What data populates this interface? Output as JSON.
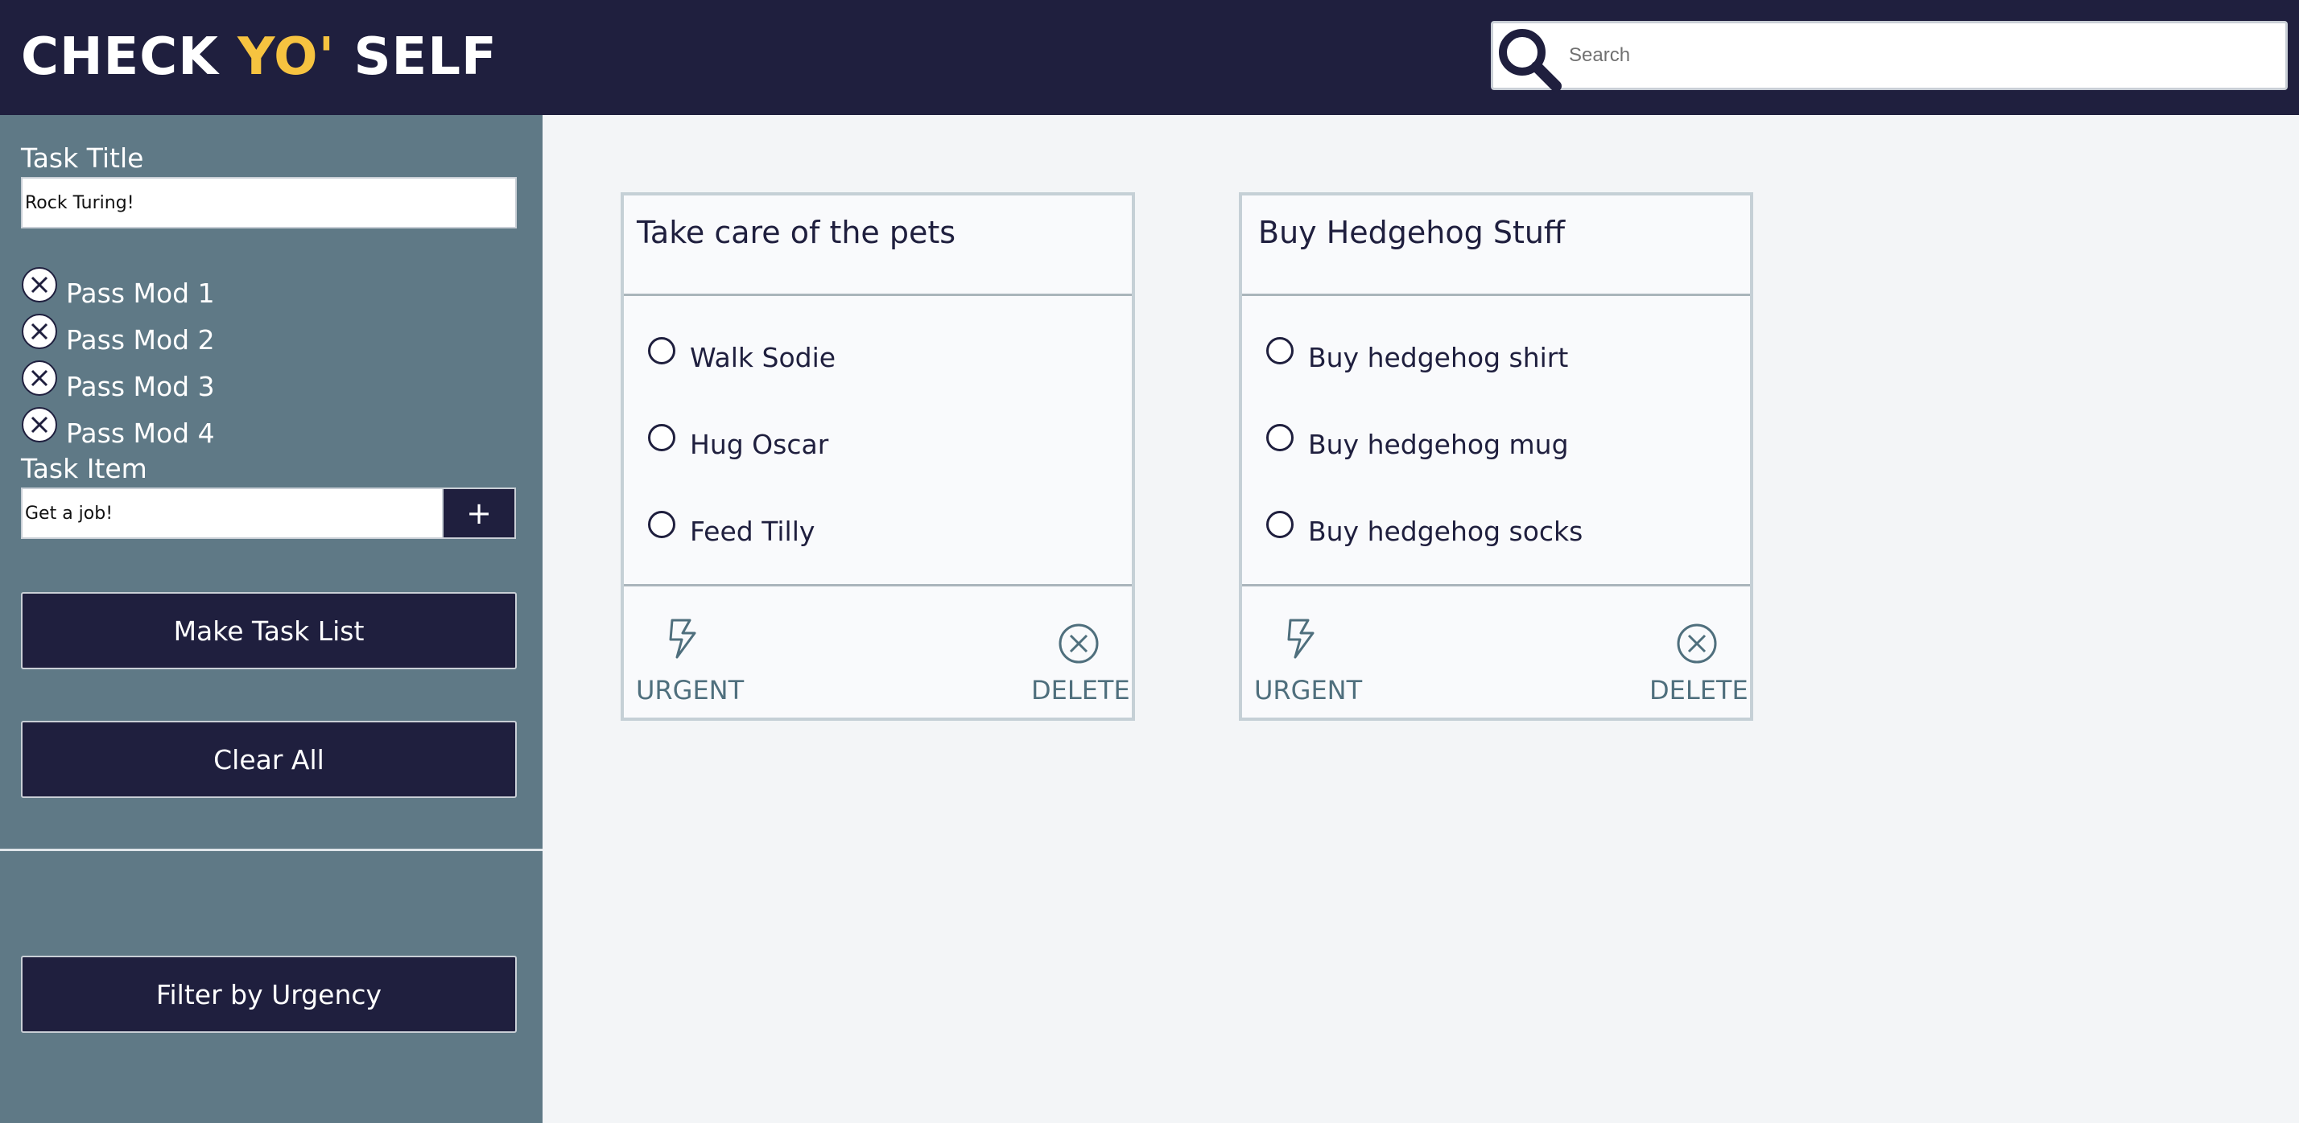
{
  "header": {
    "logo_part1": "CHECK ",
    "logo_accent": "YO'",
    "logo_part2": " SELF",
    "search_placeholder": "Search"
  },
  "sidebar": {
    "task_title_label": "Task Title",
    "task_title_value": "Rock Turing!",
    "pending_items": [
      "Pass Mod 1",
      "Pass Mod 2",
      "Pass Mod 3",
      "Pass Mod 4"
    ],
    "task_item_label": "Task Item",
    "task_item_value": "Get a job!",
    "add_item_label": "+",
    "make_task_list_label": "Make Task List",
    "clear_all_label": "Clear All",
    "filter_label": "Filter by Urgency"
  },
  "cards": [
    {
      "title": "Take care of the pets",
      "items": [
        "Walk Sodie",
        "Hug Oscar",
        "Feed Tilly"
      ],
      "urgent_label": "URGENT",
      "delete_label": "DELETE"
    },
    {
      "title": "Buy Hedgehog Stuff",
      "items": [
        "Buy hedgehog shirt",
        "Buy hedgehog mug",
        "Buy hedgehog socks"
      ],
      "urgent_label": "URGENT",
      "delete_label": "DELETE"
    }
  ],
  "icons": {
    "search": "search-icon",
    "remove_item": "close-circle-icon",
    "urgent": "lightning-icon",
    "delete": "close-circle-icon",
    "checkbox": "radio-circle-icon"
  },
  "colors": {
    "navy": "#1f1f3e",
    "accent": "#f6c340",
    "sidebar": "#5f7986",
    "page": "#f3f5f7",
    "action_text": "#4f6f7d"
  }
}
